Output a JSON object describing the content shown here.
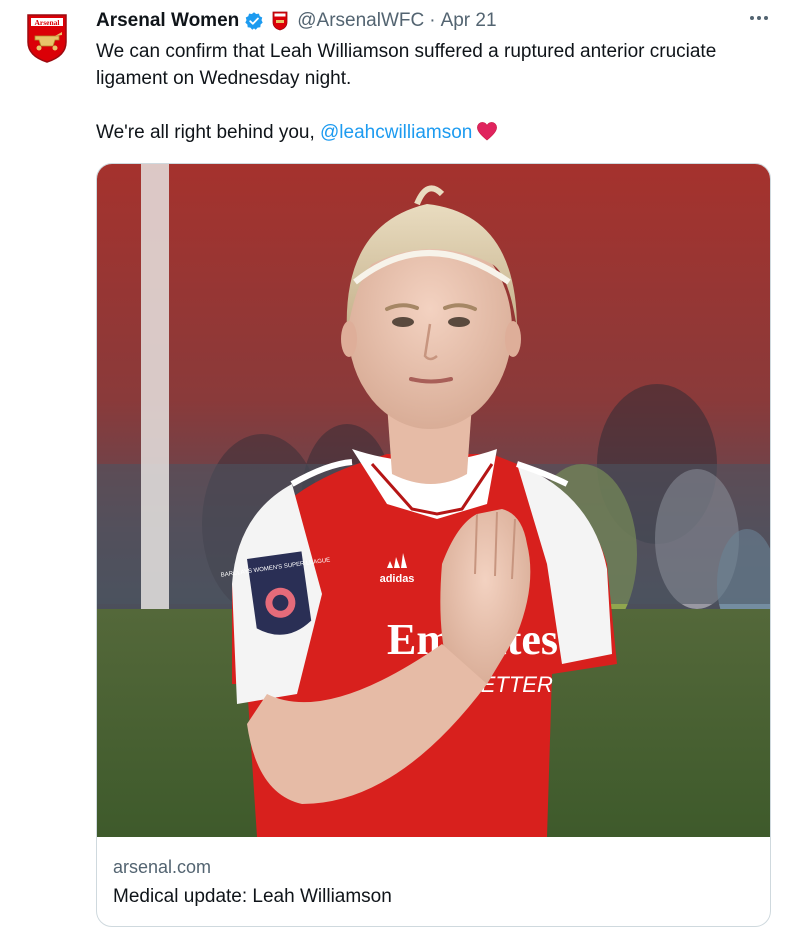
{
  "tweet": {
    "author": {
      "display_name": "Arsenal Women",
      "handle": "@ArsenalWFC",
      "separator": "·",
      "date": "Apr 21",
      "avatar_text": "Arsenal"
    },
    "body": {
      "line1": "We can confirm that Leah Williamson suffered a ruptured anterior cruciate ligament on Wednesday night.",
      "line2_prefix": "We're all right behind you, ",
      "mention": "@leahcwilliamson"
    },
    "card": {
      "domain": "arsenal.com",
      "title": "Medical update: Leah Williamson",
      "image_alt": "Leah Williamson in an Arsenal shirt with hand on chest",
      "sponsor_text": "Emirates",
      "sponsor_sub": "FLY BETTER",
      "kit_brand": "adidas",
      "badge_text": "BARCLAYS WOMEN'S SUPER LEAGUE"
    },
    "icons": {
      "verified": "verified-badge-icon",
      "affiliate": "arsenal-crest-icon",
      "more": "more-options-icon",
      "heart": "red-heart-emoji"
    }
  },
  "colors": {
    "text_primary": "#0f1419",
    "text_secondary": "#536471",
    "link": "#1d9bf0",
    "arsenal_red": "#db0007",
    "verified_blue": "#1d9bf0",
    "card_border": "#cfd9de"
  }
}
